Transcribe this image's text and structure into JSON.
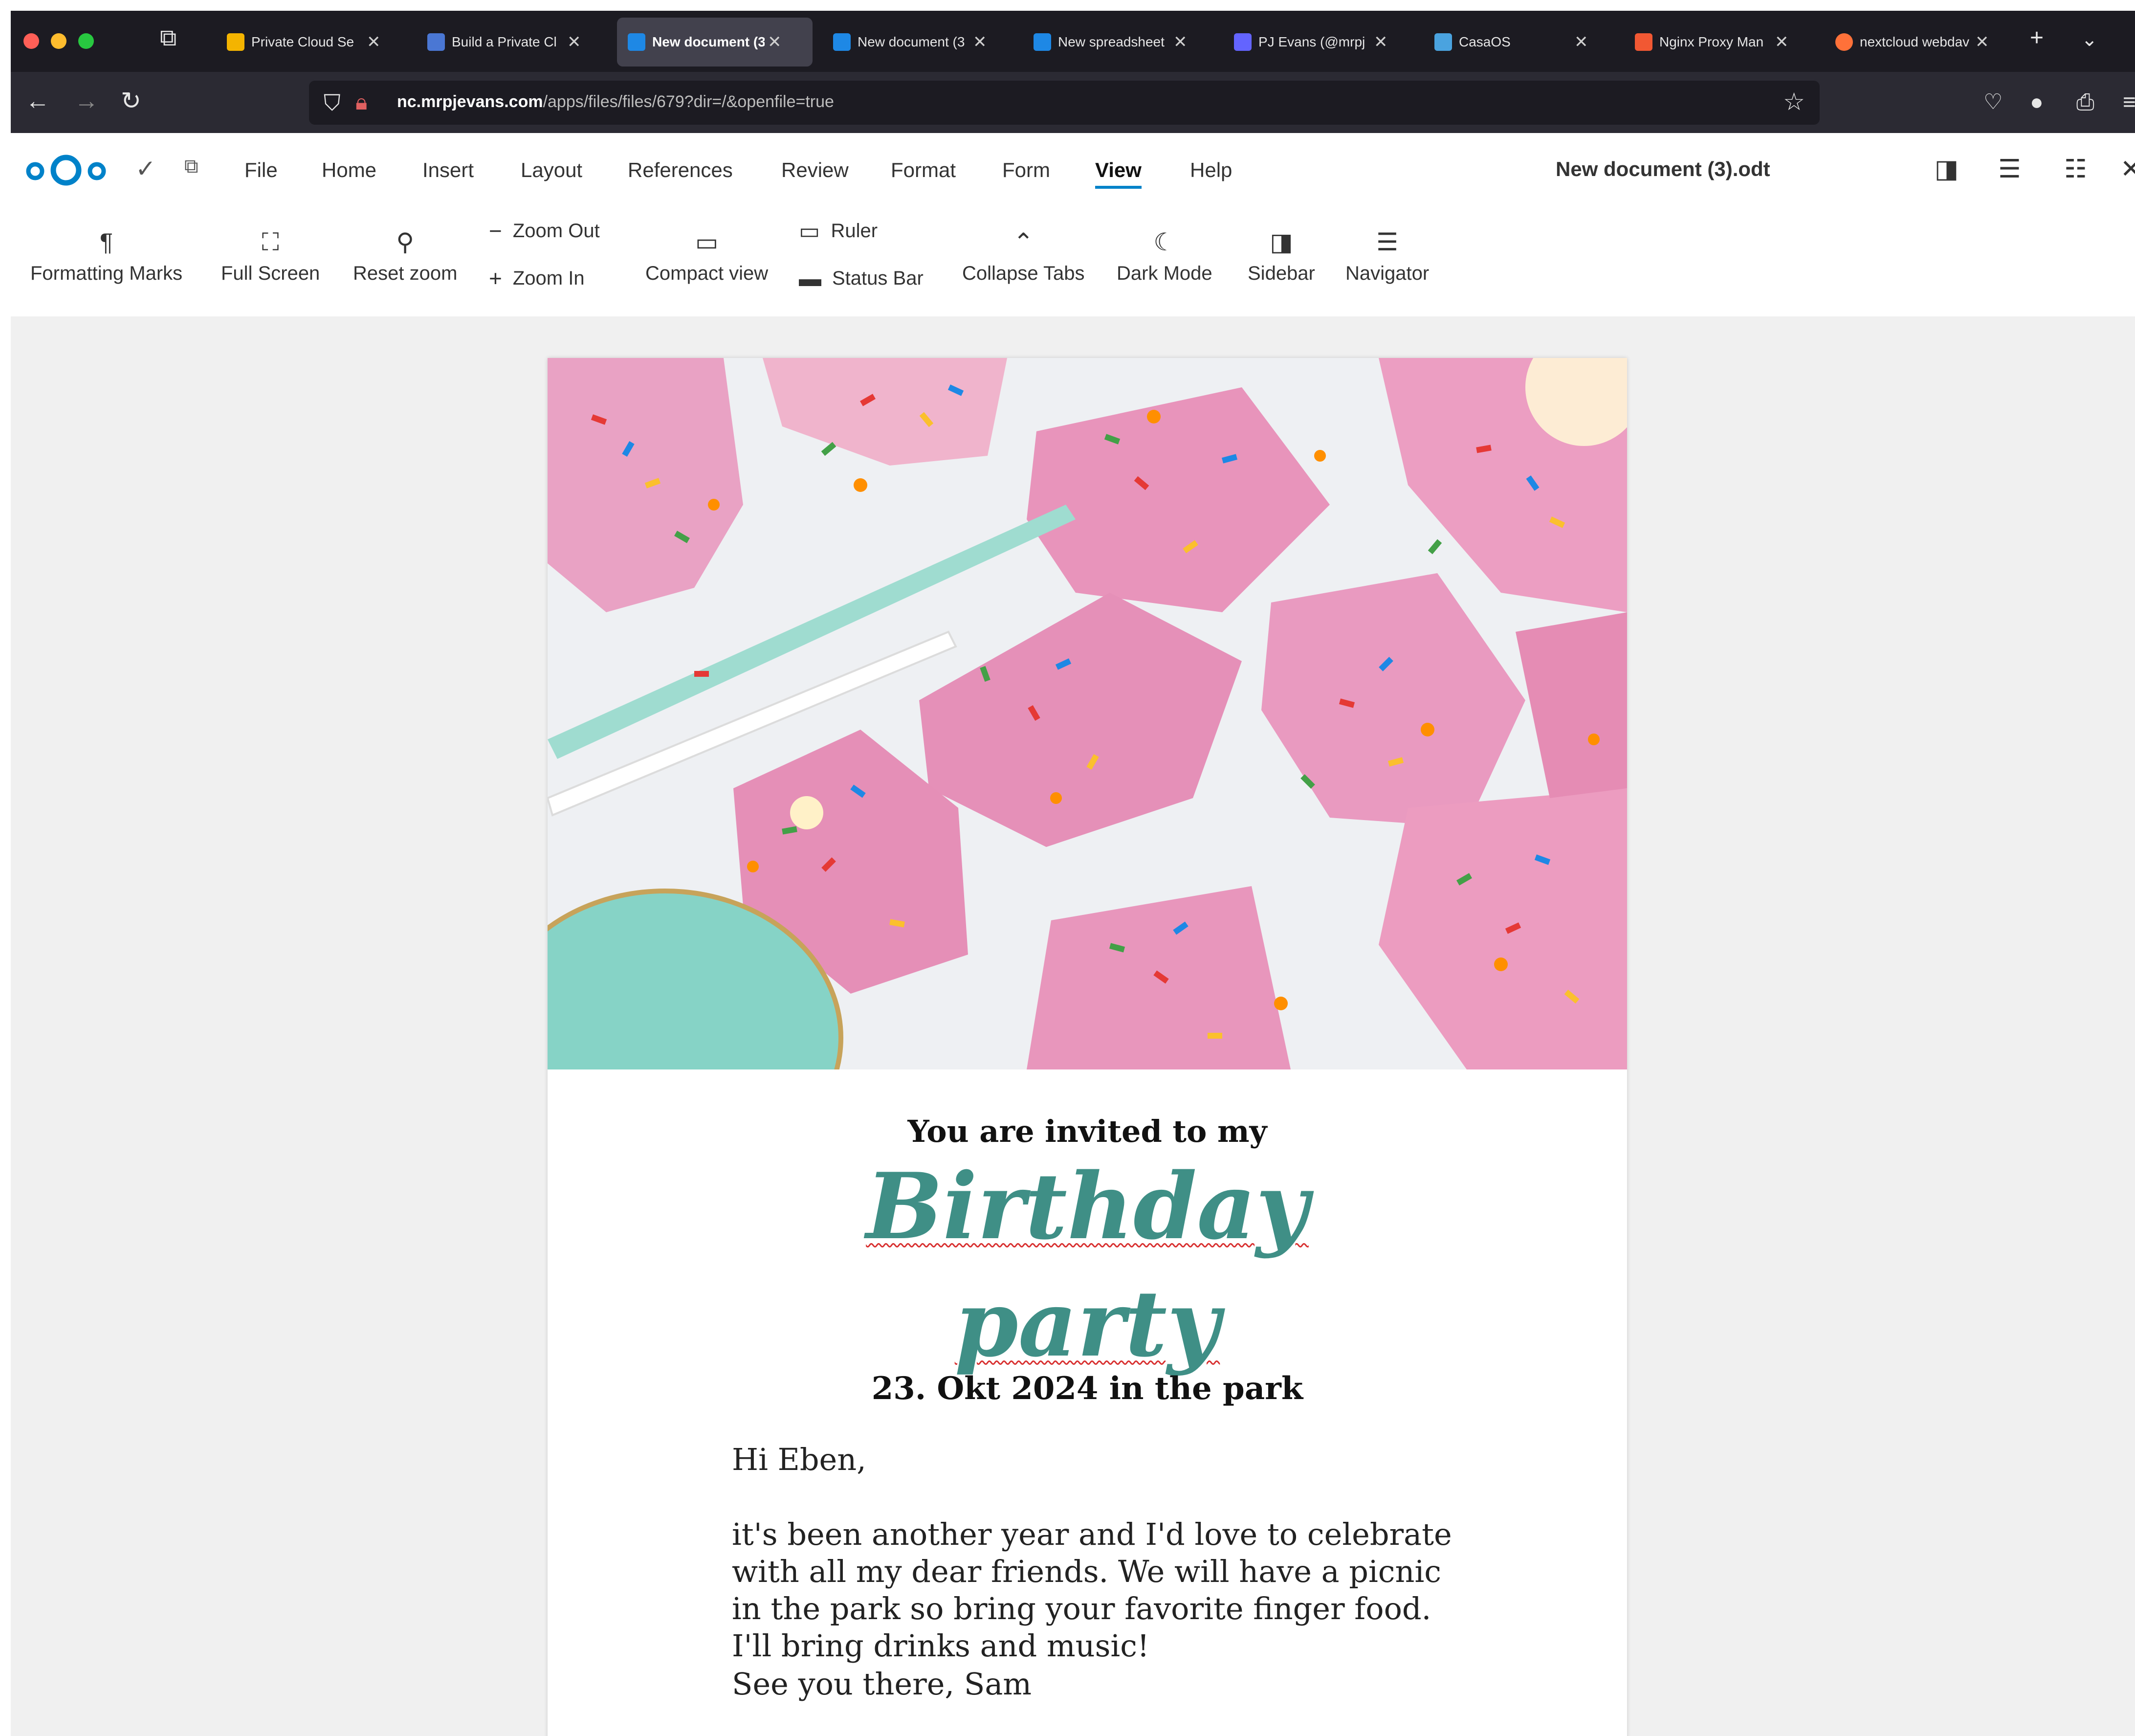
{
  "browser": {
    "tabs": [
      {
        "title": "Private Cloud Se",
        "favicon_color": "#f4b400"
      },
      {
        "title": "Build a Private Cl",
        "favicon_color": "#4a77d4"
      },
      {
        "title": "New document (3",
        "favicon_color": "#1e88e5"
      },
      {
        "title": "New document (3",
        "favicon_color": "#1e88e5"
      },
      {
        "title": "New spreadsheet",
        "favicon_color": "#1e88e5"
      },
      {
        "title": "PJ Evans (@mrpj",
        "favicon_color": "#6364ff"
      },
      {
        "title": "CasaOS",
        "favicon_color": "#4aa3df"
      },
      {
        "title": "Nginx Proxy Man",
        "favicon_color": "#f15833"
      },
      {
        "title": "nextcloud webdav",
        "favicon_color": "#ff7139"
      }
    ],
    "active_tab_index": 2,
    "url_host": "nc.mrpjevans.com",
    "url_path": "/apps/files/files/679?dir=/&openfile=true"
  },
  "app": {
    "menu": [
      "File",
      "Home",
      "Insert",
      "Layout",
      "References",
      "Review",
      "Format",
      "Form",
      "View",
      "Help"
    ],
    "active_menu": "View",
    "document_name": "New document (3).odt",
    "accent_color": "#0082c9"
  },
  "toolbar": {
    "formatting_marks": "Formatting Marks",
    "full_screen": "Full Screen",
    "reset_zoom": "Reset zoom",
    "zoom_out": "Zoom Out",
    "zoom_in": "Zoom In",
    "compact_view": "Compact view",
    "ruler": "Ruler",
    "status_bar": "Status Bar",
    "collapse_tabs": "Collapse Tabs",
    "dark_mode": "Dark Mode",
    "sidebar": "Sidebar",
    "navigator": "Navigator"
  },
  "document": {
    "invite_line": "You are invited to my",
    "title_line1": "Birthday",
    "title_line2": "party",
    "date_line": "23. Okt 2024 in the park",
    "greeting": "Hi Eben,",
    "paragraph_lines": [
      "it's been another year and I'd love to celebrate",
      "with all my dear friends. We will have a picnic",
      "in the park so bring your favorite finger food.",
      "I'll bring drinks and music!"
    ],
    "signoff": "See you there, Sam",
    "title_color": "#3f8f86"
  }
}
